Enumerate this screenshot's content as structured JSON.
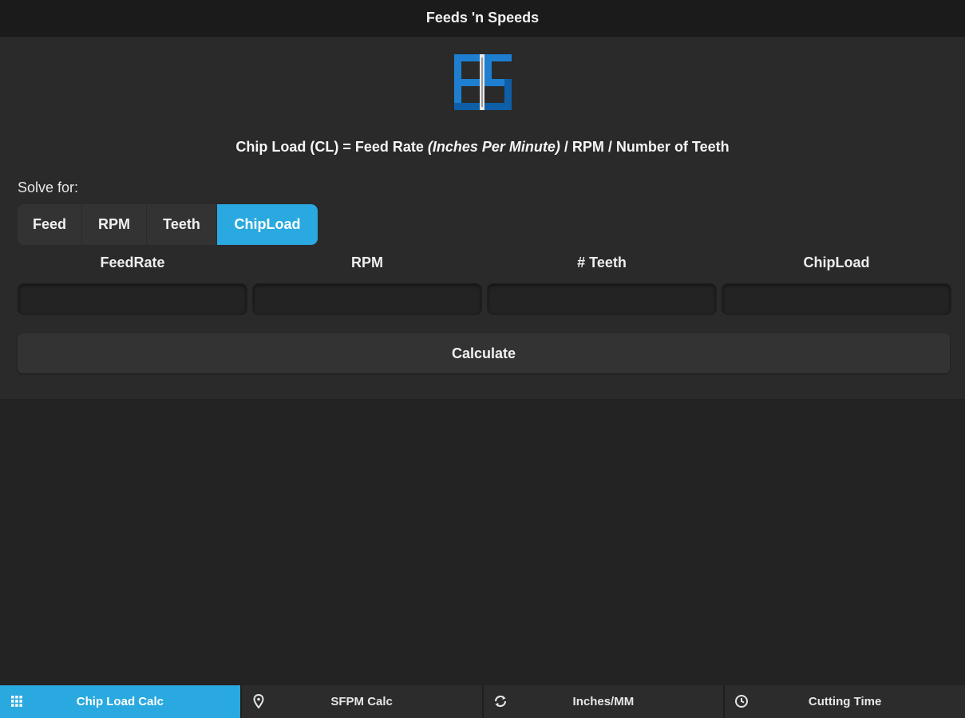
{
  "app": {
    "title": "Feeds 'n Speeds"
  },
  "formula": {
    "prefix": "Chip Load (CL) = Feed Rate ",
    "italic": "(Inches Per Minute)",
    "suffix": " / RPM / Number of Teeth"
  },
  "solve": {
    "label": "Solve for:",
    "options": [
      "Feed",
      "RPM",
      "Teeth",
      "ChipLoad"
    ],
    "selected": "ChipLoad"
  },
  "fields": [
    {
      "label": "FeedRate",
      "value": ""
    },
    {
      "label": "RPM",
      "value": ""
    },
    {
      "label": "# Teeth",
      "value": ""
    },
    {
      "label": "ChipLoad",
      "value": ""
    }
  ],
  "calculate_label": "Calculate",
  "tabs": [
    {
      "label": "Chip Load Calc",
      "icon": "grid-icon",
      "active": true
    },
    {
      "label": "SFPM Calc",
      "icon": "map-pin-icon",
      "active": false
    },
    {
      "label": "Inches/MM",
      "icon": "refresh-icon",
      "active": false
    },
    {
      "label": "Cutting Time",
      "icon": "clock-icon",
      "active": false
    }
  ],
  "colors": {
    "accent": "#29a9e0",
    "background": "#2a2a2a",
    "bar": "#1b1b1b"
  }
}
